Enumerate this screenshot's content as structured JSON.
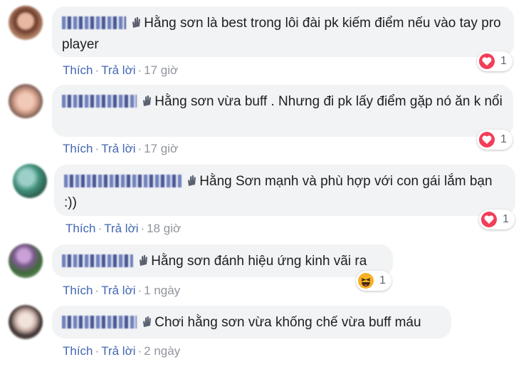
{
  "comments": [
    {
      "text": "Hằng sơn là best trong lôi đài pk kiếm điểm nếu vào tay pro player",
      "like_label": "Thích",
      "reply_label": "Trả lời",
      "time": "17 giờ",
      "reaction": {
        "icon": "heart-icon",
        "count": "1"
      }
    },
    {
      "text": "Hằng sơn vừa buff . Nhưng đi pk lấy điểm gặp nó ăn k nổi",
      "like_label": "Thích",
      "reply_label": "Trả lời",
      "time": "17 giờ",
      "reaction": {
        "icon": "heart-icon",
        "count": "1"
      }
    },
    {
      "text": "Hằng Sơn mạnh và phù hợp với con gái lắm bạn :))",
      "like_label": "Thích",
      "reply_label": "Trả lời",
      "time": "18 giờ",
      "reaction": {
        "icon": "heart-icon",
        "count": "1"
      }
    },
    {
      "text": "Hằng sơn đánh hiệu ứng kinh vãi ra",
      "like_label": "Thích",
      "reply_label": "Trả lời",
      "time": "1 ngày",
      "reaction": {
        "icon": "laugh-icon",
        "count": "1"
      }
    },
    {
      "text": "Chơi hằng sơn vừa khống chế vừa buff máu",
      "like_label": "Thích",
      "reply_label": "Trả lời",
      "time": "2 ngày",
      "reaction": null
    }
  ],
  "colors": {
    "link": "#4267b2",
    "bubble": "#f2f3f5",
    "heart": "#f33e58",
    "laugh": "#f7b125"
  }
}
